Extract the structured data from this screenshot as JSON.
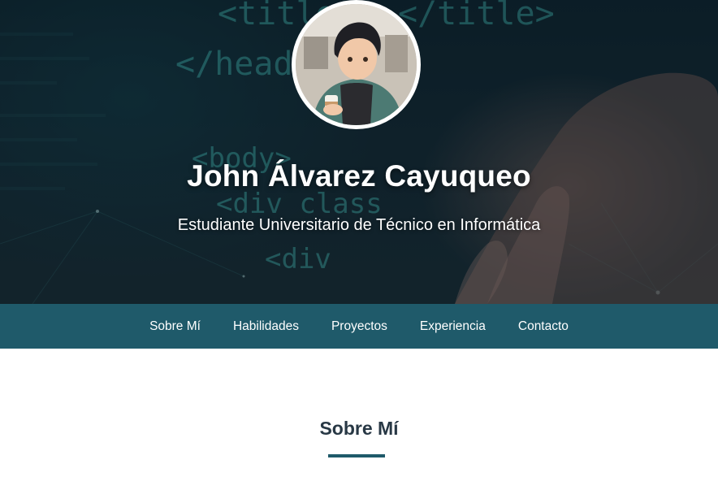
{
  "hero": {
    "name": "John Álvarez Cayuqueo",
    "subtitle": "Estudiante Universitario de Técnico en Informática",
    "code_text": [
      "<title>",
      "</title>",
      "</head>",
      "<body>",
      "<div class",
      "<div"
    ],
    "avatar_icon": "profile-photo"
  },
  "nav": {
    "items": [
      {
        "label": "Sobre Mí"
      },
      {
        "label": "Habilidades"
      },
      {
        "label": "Proyectos"
      },
      {
        "label": "Experiencia"
      },
      {
        "label": "Contacto"
      }
    ]
  },
  "section": {
    "title": "Sobre Mí"
  },
  "colors": {
    "nav_bg": "#1f5a6a",
    "title_text": "#283845",
    "accent": "#1f5a6a"
  }
}
